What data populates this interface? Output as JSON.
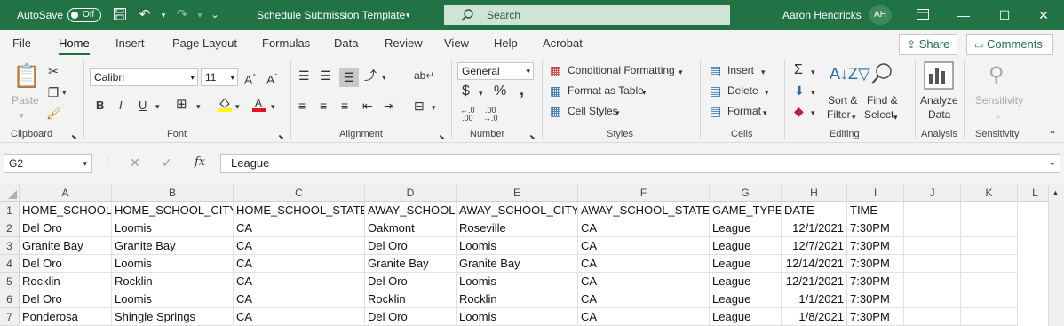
{
  "titlebar": {
    "autosave_label": "AutoSave",
    "autosave_state": "Off",
    "doc_title": "Schedule Submission Template",
    "search_placeholder": "Search",
    "user_name": "Aaron Hendricks",
    "user_initials": "AH",
    "accent": "#217346"
  },
  "menu": {
    "tabs": [
      "File",
      "Home",
      "Insert",
      "Page Layout",
      "Formulas",
      "Data",
      "Review",
      "View",
      "Help",
      "Acrobat"
    ],
    "active_tab": "Home",
    "share_label": "Share",
    "comments_label": "Comments"
  },
  "ribbon": {
    "clipboard": {
      "paste": "Paste",
      "label": "Clipboard"
    },
    "font": {
      "name": "Calibri",
      "size": "11",
      "bold": "B",
      "italic": "I",
      "underline": "U",
      "label": "Font"
    },
    "alignment": {
      "label": "Alignment"
    },
    "number": {
      "format": "General",
      "currency": "$",
      "percent": "%",
      "comma": ",",
      "label": "Number"
    },
    "styles": {
      "conditional": "Conditional Formatting",
      "table": "Format as Table",
      "cell": "Cell Styles",
      "label": "Styles"
    },
    "cells": {
      "insert": "Insert",
      "delete": "Delete",
      "format": "Format",
      "label": "Cells"
    },
    "editing": {
      "sort_line1": "Sort &",
      "sort_line2": "Filter",
      "find_line1": "Find &",
      "find_line2": "Select",
      "label": "Editing"
    },
    "analysis": {
      "line1": "Analyze",
      "line2": "Data",
      "label": "Analysis"
    },
    "sensitivity": {
      "button": "Sensitivity",
      "label": "Sensitivity"
    }
  },
  "formula_bar": {
    "name_box": "G2",
    "fx": "fx",
    "value": "League"
  },
  "sheet": {
    "columns": [
      "A",
      "B",
      "C",
      "D",
      "E",
      "F",
      "G",
      "H",
      "I",
      "J",
      "K",
      "L"
    ],
    "rows": [
      {
        "num": "1",
        "cells": [
          "HOME_SCHOOL",
          "HOME_SCHOOL_CITY",
          "HOME_SCHOOL_STATE",
          "AWAY_SCHOOL",
          "AWAY_SCHOOL_CITY",
          "AWAY_SCHOOL_STATE",
          "GAME_TYPE",
          "DATE",
          "TIME",
          "",
          ""
        ]
      },
      {
        "num": "2",
        "cells": [
          "Del Oro",
          "Loomis",
          "CA",
          "Oakmont",
          "Roseville",
          "CA",
          "League",
          "12/1/2021",
          "7:30PM",
          "",
          ""
        ]
      },
      {
        "num": "3",
        "cells": [
          "Granite Bay",
          "Granite Bay",
          "CA",
          "Del Oro",
          "Loomis",
          "CA",
          "League",
          "12/7/2021",
          "7:30PM",
          "",
          ""
        ]
      },
      {
        "num": "4",
        "cells": [
          "Del Oro",
          "Loomis",
          "CA",
          "Granite Bay",
          "Granite Bay",
          "CA",
          "League",
          "12/14/2021",
          "7:30PM",
          "",
          ""
        ]
      },
      {
        "num": "5",
        "cells": [
          "Rocklin",
          "Rocklin",
          "CA",
          "Del Oro",
          "Loomis",
          "CA",
          "League",
          "12/21/2021",
          "7:30PM",
          "",
          ""
        ]
      },
      {
        "num": "6",
        "cells": [
          "Del Oro",
          "Loomis",
          "CA",
          "Rocklin",
          "Rocklin",
          "CA",
          "League",
          "1/1/2021",
          "7:30PM",
          "",
          ""
        ]
      },
      {
        "num": "7",
        "cells": [
          "Ponderosa",
          "Shingle Springs",
          "CA",
          "Del Oro",
          "Loomis",
          "CA",
          "League",
          "1/8/2021",
          "7:30PM",
          "",
          ""
        ]
      }
    ]
  }
}
